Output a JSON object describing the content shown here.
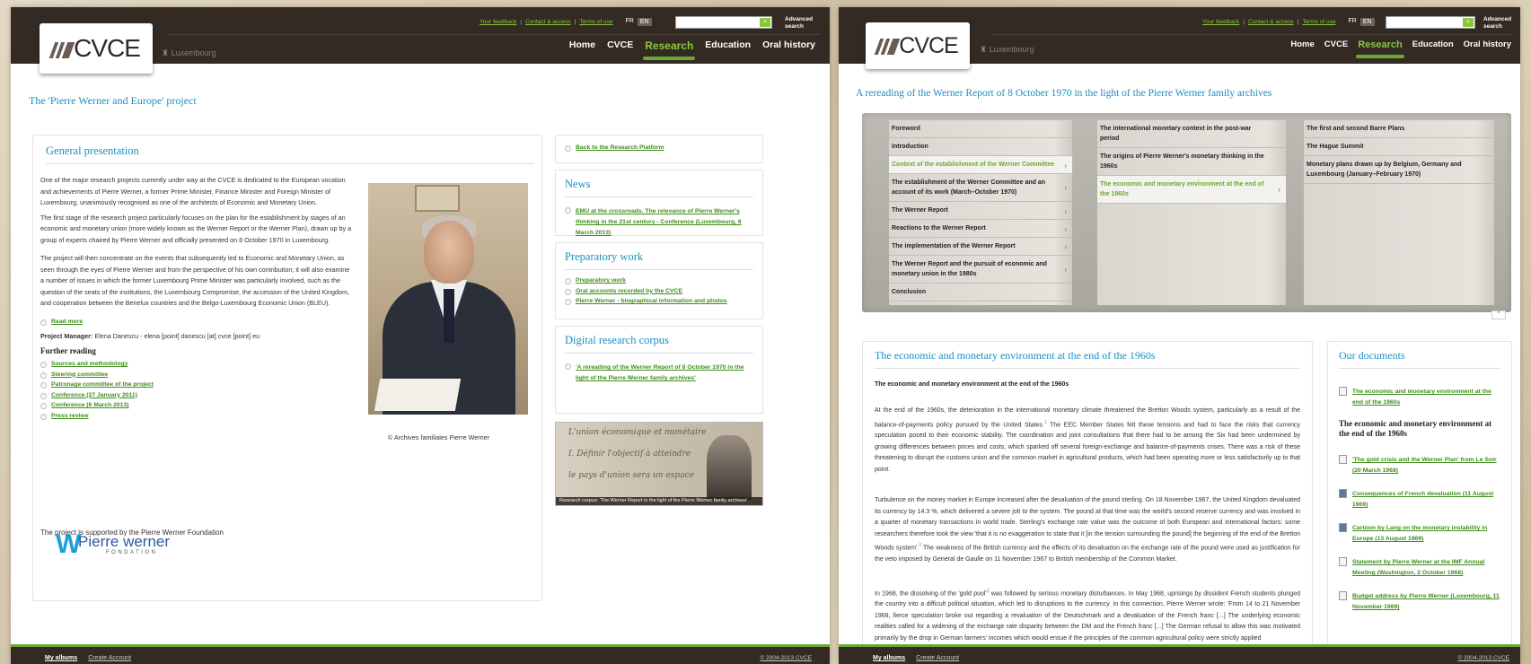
{
  "colors": {
    "accent": "#8cc63f",
    "title_blue": "#1a8fc0",
    "header": "#332a24"
  },
  "header": {
    "logo": "CVCE",
    "location": "Luxembourg",
    "top_links": [
      "Your feedback",
      "Contact & access",
      "Terms of use"
    ],
    "lang_fr": "FR",
    "lang_en": "EN",
    "advanced_search": "Advanced search",
    "nav": [
      "Home",
      "CVCE",
      "Research",
      "Education",
      "Oral history"
    ]
  },
  "left": {
    "page_title": "The 'Pierre Werner and Europe' project",
    "main": {
      "heading": "General presentation",
      "paragraphs": [
        "One of the major research projects currently under way at the CVCE is dedicated to the European vocation and achievements of Pierre Werner, a former Prime Minister, Finance Minister and Foreign Minister of Luxembourg, unanimously recognised as one of the architects of Economic and Monetary Union.",
        "The first stage of the research project particularly focuses on the plan for the establishment by stages of an economic and monetary union (more widely known as the Werner Report or the Werner Plan), drawn up by a group of experts chaired by Pierre Werner and officially presented on 8 October 1970 in Luxembourg.",
        "The project will then concentrate on the events that subsequently led to Economic and Monetary Union, as seen through the eyes of Pierre Werner and from the perspective of his own contribution; it will also examine a number of issues in which the former Luxembourg Prime Minister was particularly involved, such as the question of the seats of the institutions, the Luxembourg Compromise, the accession of the United Kingdom, and cooperation between the Benelux countries and the Belgo-Luxembourg Economic Union (BLEU)."
      ],
      "read_more": "Read more",
      "manager_label": "Project Manager:",
      "manager_value": " Elena Danescu - elena [point] danescu [at] cvce [point] eu",
      "further_heading": "Further reading",
      "further_links": [
        "Sources and methodology",
        "Steering committee",
        "Patronage committee of the project",
        "Conference (27 January 2011)",
        "Conference (6 March 2013)",
        "Press review"
      ],
      "photo_caption": "© Archives familiales Pierre Werner",
      "supported": "The project is supported by the Pierre Werner Foundation",
      "foundation_name": "Pierre werner",
      "foundation_sub": "FONDATION"
    },
    "side": {
      "back_link": "Back to the Research Platform",
      "news_heading": "News",
      "news_link": "EMU at the crossroads. The relevance of Pierre Werner's thinking in the 21st century - Conference (Luxembourg, 6 March 2013)",
      "prep_heading": "Preparatory work",
      "prep_links": [
        "Preparatory work",
        "Oral accounts recorded by the CVCE",
        "Pierre Werner - biographical information and photos"
      ],
      "corpus_heading": "Digital research corpus",
      "corpus_link": "'A rereading of the Werner Report of 8 October 1970 in the light of the Pierre Werner family archives'",
      "corpus_caption": "Research corpus: 'The Werner Report in the light of the Pierre Werner family archives'"
    }
  },
  "right": {
    "page_title": "A rereading of the Werner Report of 8 October 1970 in the light of the Pierre Werner family archives",
    "menu_col1": [
      {
        "label": "Foreword",
        "arrow": false,
        "sel": false
      },
      {
        "label": "Introduction",
        "arrow": false,
        "sel": false
      },
      {
        "label": "Context of the establishment of the Werner Committee",
        "arrow": true,
        "sel": true
      },
      {
        "label": "The establishment of the Werner Committee and an account of its work (March–October 1970)",
        "arrow": true,
        "sel": false
      },
      {
        "label": "The Werner Report",
        "arrow": true,
        "sel": false
      },
      {
        "label": "Reactions to the Werner Report",
        "arrow": true,
        "sel": false
      },
      {
        "label": "The implementation of the Werner Report",
        "arrow": true,
        "sel": false
      },
      {
        "label": "The Werner Report and the pursuit of economic and monetary union in the 1980s",
        "arrow": true,
        "sel": false
      },
      {
        "label": "Conclusion",
        "arrow": false,
        "sel": false
      }
    ],
    "menu_col2": [
      {
        "label": "The international monetary context in the post-war period",
        "arrow": false,
        "sel": false
      },
      {
        "label": "The origins of Pierre Werner's monetary thinking in the 1960s",
        "arrow": false,
        "sel": false
      },
      {
        "label": "The economic and monetary environment at the end of the 1960s",
        "arrow": true,
        "sel": true
      }
    ],
    "menu_col3": [
      {
        "label": "The first and second Barre Plans",
        "arrow": false,
        "sel": false
      },
      {
        "label": "The Hague Summit",
        "arrow": false,
        "sel": false
      },
      {
        "label": "Monetary plans drawn up by Belgium, Germany and Luxembourg (January–February 1970)",
        "arrow": false,
        "sel": false
      }
    ],
    "article": {
      "heading": "The economic and monetary environment at the end of the 1960s",
      "subheading": "The economic and monetary environment at the end of the 1960s",
      "p1a": "At the end of the 1960s, the deterioration in the international monetary climate threatened the Bretton Woods system, particularly as a result of the balance-of-payments policy pursued by the United States.",
      "fn1": "1",
      "p1b": " The EEC Member States felt these tensions and had to face the risks that currency speculation posed to their economic stability. The coordination and joint consultations that there had to be among the Six had been undermined by growing differences between prices and costs, which sparked off several foreign-exchange and balance-of-payments crises. There was a risk of these threatening to disrupt the customs union and the common market in agricultural products, which had been operating more or less satisfactorily up to that point.",
      "p2a": "Turbulence on the money market in Europe increased after the devaluation of the pound sterling. On 18 November 1967, the United Kingdom devaluated its currency by 14.3 %, which delivered a severe jolt to the system. The pound at that time was the world's second reserve currency and was involved in a quarter of monetary transactions in world trade. Sterling's exchange rate value was the outcome of both European and international factors: some researchers therefore took the view 'that it is no exaggeration to state that it [in the tension surrounding the pound] the beginning of the end of the Bretton Woods system'.",
      "fn2": "2",
      "p2b": " The weakness of the British currency and the effects of its devaluation on the exchange rate of the pound were used as justification for the veto imposed by General de Gaulle on 11 November 1967 to British membership of the Common Market.",
      "p3a": "In 1968, the dissolving of the 'gold pool'",
      "fn3": "3",
      "p3b": " was followed by serious monetary disturbances. In May 1968, uprisings by dissident French students plunged the country into a difficult political situation, which led to disruptions to the currency. In this connection, Pierre Werner wrote: 'From 14 to 21 November 1968, fierce speculation broke out regarding a revaluation of the Deutschmark and a devaluation of the French franc [...] The underlying economic realities called for a widening of the exchange rate disparity between the DM and the French franc [...] The German refusal to allow this was motivated primarily by the drop in German farmers' incomes which would ensue if the principles of the common agricultural policy were strictly applied"
    },
    "docs": {
      "heading": "Our documents",
      "first": "The economic and monetary environment at the end of the 1960s",
      "bold": "The economic and monetary environment at the end of the 1960s",
      "items": [
        {
          "label": "'The gold crisis and the Werner Plan' from Le Soir (20 March 1968)",
          "img": false
        },
        {
          "label": "Consequences of French devaluation (11 August 1969)",
          "img": true
        },
        {
          "label": "Cartoon by Lang on the monetary instability in Europe (13 August 1969)",
          "img": true
        },
        {
          "label": "Statement by Pierre Werner at the IMF Annual Meeting (Washington, 2 October 1968)",
          "img": false
        },
        {
          "label": "Budget address by Pierre Werner (Luxembourg, 11 November 1969)",
          "img": false
        }
      ]
    }
  },
  "footer": {
    "my_albums": "My albums",
    "create": "Create Account",
    "copyright": "© 2004-2013 CVCE"
  }
}
